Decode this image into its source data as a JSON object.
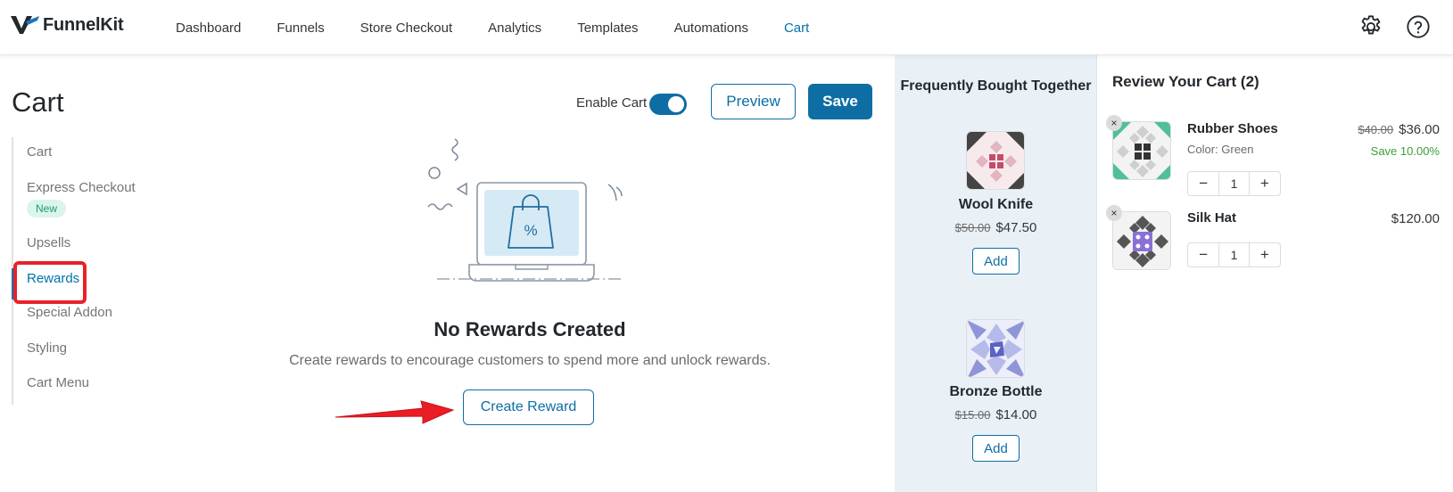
{
  "app": {
    "logo_text": "FunnelKit",
    "nav": [
      {
        "label": "Dashboard"
      },
      {
        "label": "Funnels"
      },
      {
        "label": "Store Checkout"
      },
      {
        "label": "Analytics"
      },
      {
        "label": "Templates"
      },
      {
        "label": "Automations"
      },
      {
        "label": "Cart",
        "active": true
      }
    ],
    "icons": {
      "settings": "gear-icon",
      "help": "help-icon"
    },
    "colors": {
      "accent": "#0e6ea4",
      "nav_active": "#0073aa",
      "highlight": "#e8212a",
      "panel_bg": "#e9f1f7",
      "save_text": "#3a9e3a"
    }
  },
  "page": {
    "title": "Cart",
    "sidebar": {
      "items": [
        {
          "label": "Cart"
        },
        {
          "label": "Express Checkout",
          "badge": "New"
        },
        {
          "label": "Upsells"
        },
        {
          "label": "Rewards",
          "active": true
        },
        {
          "label": "Special Addon"
        },
        {
          "label": "Styling"
        },
        {
          "label": "Cart Menu"
        }
      ]
    },
    "header": {
      "enable_label": "Enable Cart",
      "enable_on": true,
      "preview_label": "Preview",
      "save_label": "Save"
    },
    "empty_state": {
      "title": "No Rewards Created",
      "description": "Create rewards to encourage customers to spend more and unlock rewards.",
      "button_label": "Create Reward"
    }
  },
  "fbt": {
    "title": "Frequently Bought Together",
    "products": [
      {
        "name": "Wool Knife",
        "old_price": "$50.00",
        "price": "$47.50",
        "add_label": "Add"
      },
      {
        "name": "Bronze Bottle",
        "old_price": "$15.00",
        "price": "$14.00",
        "add_label": "Add"
      }
    ]
  },
  "cart": {
    "title": "Review Your Cart (2)",
    "items": [
      {
        "name": "Rubber Shoes",
        "variant": "Color: Green",
        "old_price": "$40.00",
        "price": "$36.00",
        "save": "Save 10.00%",
        "qty": "1"
      },
      {
        "name": "Silk Hat",
        "price": "$120.00",
        "qty": "1"
      }
    ],
    "remove_icon": "×",
    "minus": "−",
    "plus": "+"
  }
}
